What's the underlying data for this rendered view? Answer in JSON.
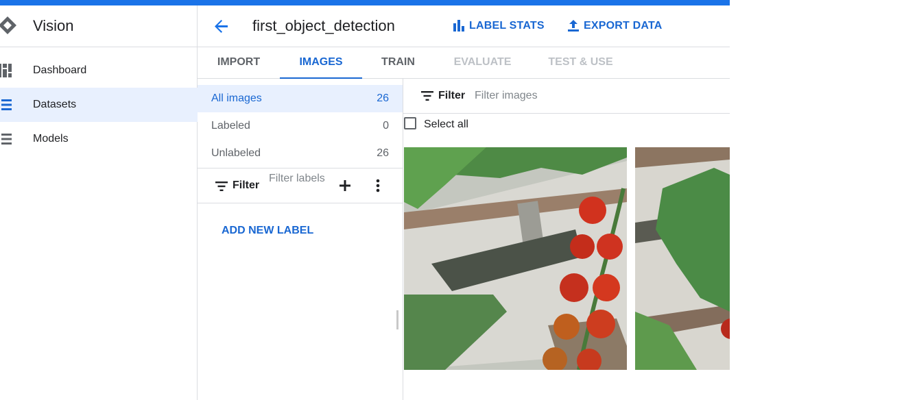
{
  "app": {
    "title": "Vision"
  },
  "sidebar": {
    "items": [
      {
        "label": "Dashboard",
        "icon": "dashboard-icon"
      },
      {
        "label": "Datasets",
        "icon": "list-icon",
        "active": true
      },
      {
        "label": "Models",
        "icon": "list-icon"
      }
    ]
  },
  "header": {
    "dataset_name": "first_object_detection",
    "actions": [
      {
        "label": "LABEL STATS",
        "icon": "bar-chart-icon"
      },
      {
        "label": "EXPORT DATA",
        "icon": "upload-icon"
      }
    ]
  },
  "tabs": [
    {
      "label": "IMPORT",
      "state": "normal"
    },
    {
      "label": "IMAGES",
      "state": "active"
    },
    {
      "label": "TRAIN",
      "state": "normal"
    },
    {
      "label": "EVALUATE",
      "state": "disabled"
    },
    {
      "label": "TEST & USE",
      "state": "disabled"
    }
  ],
  "image_counts": [
    {
      "label": "All images",
      "count": "26",
      "active": true
    },
    {
      "label": "Labeled",
      "count": "0"
    },
    {
      "label": "Unlabeled",
      "count": "26"
    }
  ],
  "label_filter": {
    "label": "Filter",
    "placeholder": "Filter labels"
  },
  "add_new_label": "ADD NEW LABEL",
  "image_filter": {
    "label": "Filter",
    "placeholder": "Filter images"
  },
  "select_all": "Select all",
  "colors": {
    "accent": "#1a73e8",
    "active_text": "#1967d2",
    "active_bg": "#e8f0fe",
    "divider": "#dadce0",
    "disabled_text": "#bdc1c6"
  }
}
